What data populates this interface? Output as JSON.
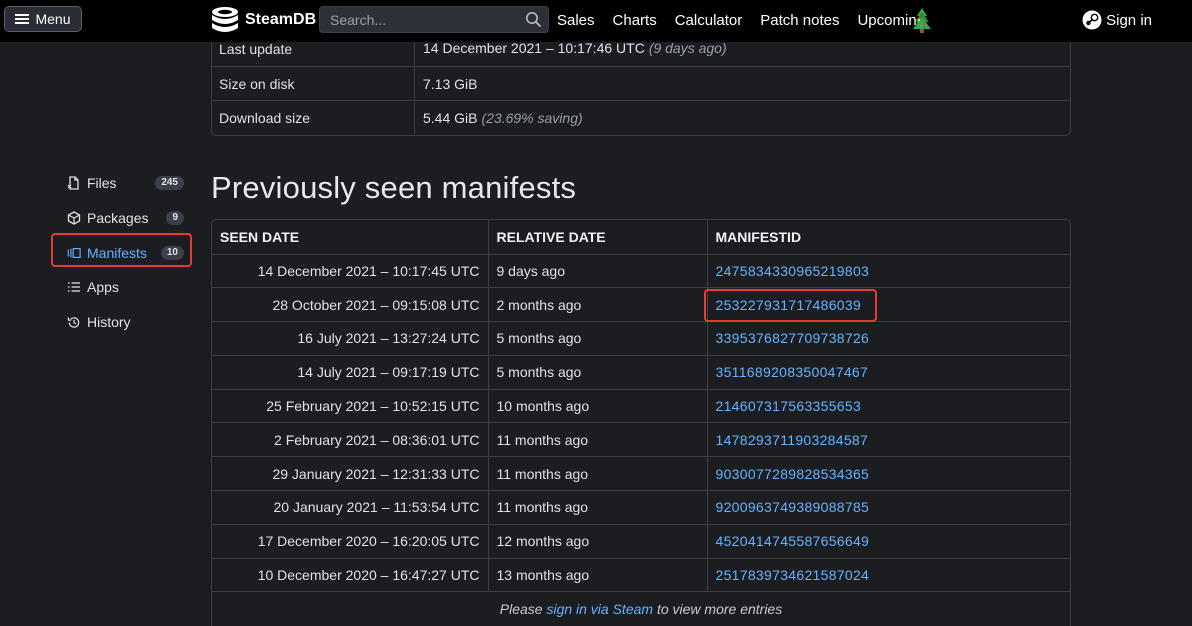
{
  "topbar": {
    "menu_label": "Menu",
    "logo_text": "SteamDB",
    "search_placeholder": "Search...",
    "nav": [
      "Sales",
      "Charts",
      "Calculator",
      "Patch notes",
      "Upcoming"
    ],
    "signin_label": "Sign in"
  },
  "info": {
    "rows": [
      {
        "label": "Last update",
        "value": "14 December 2021 – 10:17:46 UTC",
        "note": "(9 days ago)"
      },
      {
        "label": "Size on disk",
        "value": "7.13 GiB",
        "note": ""
      },
      {
        "label": "Download size",
        "value": "5.44 GiB",
        "note": "(23.69% saving)"
      }
    ]
  },
  "sidebar": {
    "items": [
      {
        "label": "Files",
        "count": "245",
        "icon": "files-icon"
      },
      {
        "label": "Packages",
        "count": "9",
        "icon": "package-icon"
      },
      {
        "label": "Manifests",
        "count": "10",
        "icon": "manifests-icon",
        "active": true
      },
      {
        "label": "Apps",
        "count": "",
        "icon": "list-icon"
      },
      {
        "label": "History",
        "count": "",
        "icon": "history-icon"
      }
    ]
  },
  "manifests": {
    "title": "Previously seen manifests",
    "headers": [
      "SEEN DATE",
      "RELATIVE DATE",
      "MANIFESTID"
    ],
    "rows": [
      {
        "seen": "14 December 2021 – 10:17:45 UTC",
        "relative": "9 days ago",
        "id": "2475834330965219803"
      },
      {
        "seen": "28 October 2021 – 09:15:08 UTC",
        "relative": "2 months ago",
        "id": "253227931717486039"
      },
      {
        "seen": "16 July 2021 – 13:27:24 UTC",
        "relative": "5 months ago",
        "id": "3395376827709738726"
      },
      {
        "seen": "14 July 2021 – 09:17:19 UTC",
        "relative": "5 months ago",
        "id": "3511689208350047467"
      },
      {
        "seen": "25 February 2021 – 10:52:15 UTC",
        "relative": "10 months ago",
        "id": "214607317563355653"
      },
      {
        "seen": "2 February 2021 – 08:36:01 UTC",
        "relative": "11 months ago",
        "id": "1478293711903284587"
      },
      {
        "seen": "29 January 2021 – 12:31:33 UTC",
        "relative": "11 months ago",
        "id": "9030077289828534365"
      },
      {
        "seen": "20 January 2021 – 11:53:54 UTC",
        "relative": "11 months ago",
        "id": "9200963749389088785"
      },
      {
        "seen": "17 December 2020 – 16:20:05 UTC",
        "relative": "12 months ago",
        "id": "4520414745587656649"
      },
      {
        "seen": "10 December 2020 – 16:47:27 UTC",
        "relative": "13 months ago",
        "id": "2517839734621587024"
      }
    ],
    "footer": {
      "before": "Please",
      "link": "sign in via Steam",
      "after": "to view more entries"
    }
  },
  "colors": {
    "accent": "#66b3ff",
    "highlight": "#e2402e",
    "background": "#1b1d21"
  }
}
